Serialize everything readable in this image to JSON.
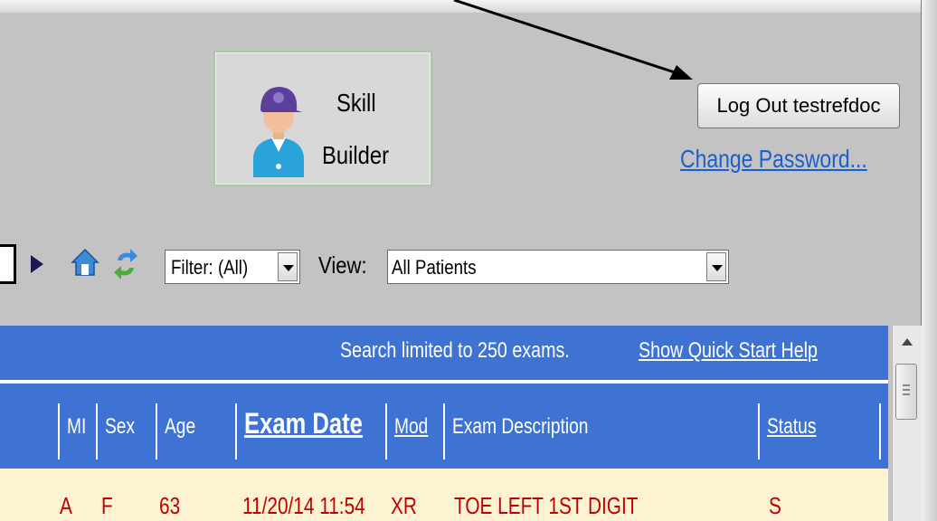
{
  "skill_builder": {
    "line1": "Skill",
    "line2": "Builder"
  },
  "account": {
    "logout_label": "Log Out testrefdoc",
    "change_password_label": "Change Password..."
  },
  "toolbar": {
    "filter_value": "Filter: (All)",
    "view_label": "View:",
    "view_value": "All Patients"
  },
  "banner": {
    "search_note": "Search limited to 250 exams.",
    "help_link": "Show Quick Start Help"
  },
  "table": {
    "columns": [
      {
        "label": "MI"
      },
      {
        "label": "Sex"
      },
      {
        "label": "Age"
      },
      {
        "label": "Exam Date"
      },
      {
        "label": "Mod"
      },
      {
        "label": "Exam Description"
      },
      {
        "label": "Status"
      }
    ],
    "rows": [
      {
        "mi": "A",
        "sex": "F",
        "age": "63",
        "exam_date": "11/20/14 11:54",
        "mod": "XR",
        "description": "TOE LEFT 1ST DIGIT",
        "status": "S"
      }
    ]
  },
  "icons": [
    "play-icon",
    "home-icon",
    "refresh-icon",
    "user-avatar-icon",
    "dropdown-arrow-icon",
    "scroll-up-icon"
  ],
  "colors": {
    "header_blue": "#3e73d3",
    "row_text_red": "#c00000",
    "link_blue": "#1a5fd0",
    "row_bg": "#fdf3d2"
  }
}
